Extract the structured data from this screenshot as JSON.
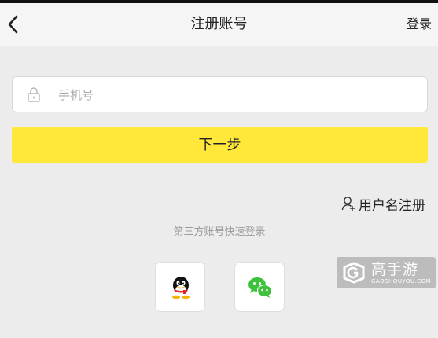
{
  "header": {
    "back_icon": "chevron-left-icon",
    "title": "注册账号",
    "login_label": "登录"
  },
  "form": {
    "phone_placeholder": "手机号",
    "phone_value": "",
    "lock_icon": "lock-icon",
    "next_label": "下一步",
    "next_color": "#ffe83a"
  },
  "username_register": {
    "icon": "user-add-icon",
    "label": "用户名注册"
  },
  "third_party": {
    "label": "第三方账号快速登录",
    "buttons": [
      {
        "icon": "qq-icon"
      },
      {
        "icon": "wechat-icon",
        "color": "#3ec23d"
      }
    ]
  },
  "watermark": {
    "brand": "高手游",
    "domain": "GAOSHOUYOU.COM"
  }
}
